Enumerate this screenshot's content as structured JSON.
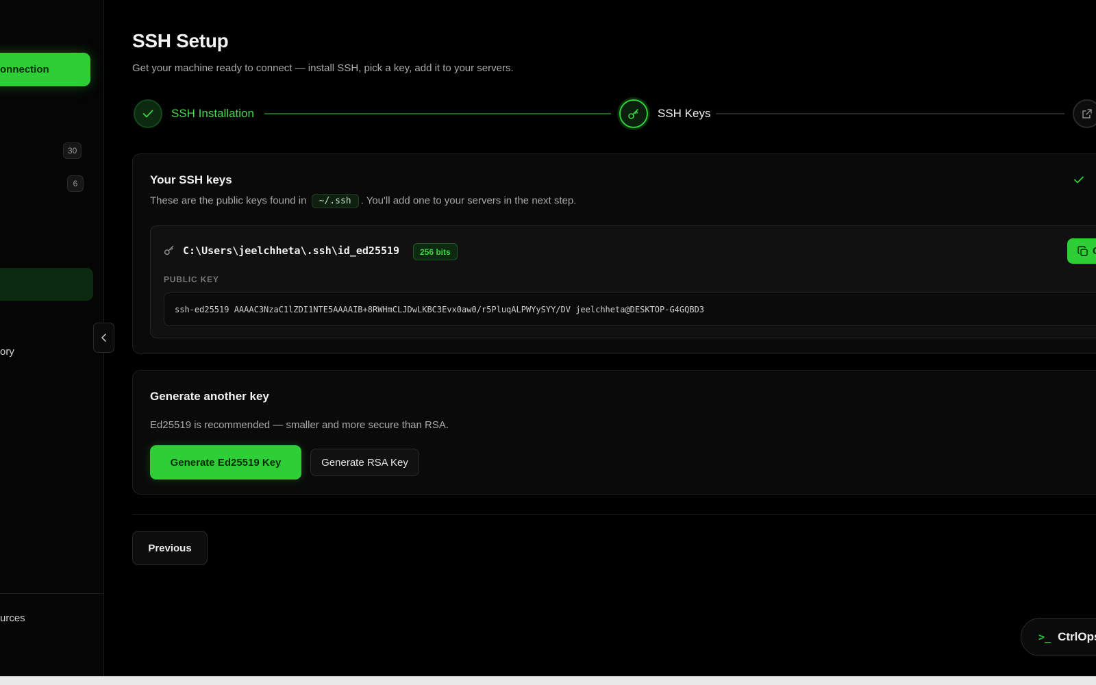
{
  "sidebar": {
    "new_connection_label": "onnection",
    "badge_a": "30",
    "badge_b": "6",
    "item_history_fragment": "ory",
    "item_resources_fragment": "urces",
    "collapse_icon": "chevron-left-icon"
  },
  "page": {
    "title": "SSH Setup",
    "subtitle": "Get your machine ready to connect — install SSH, pick a key, add it to your servers."
  },
  "stepper": {
    "steps": [
      {
        "label": "SSH Installation",
        "status": "complete",
        "icon": "check-icon"
      },
      {
        "label": "SSH Keys",
        "status": "current",
        "icon": "key-icon"
      },
      {
        "label": "",
        "status": "upcoming",
        "icon": "external-link-icon"
      }
    ]
  },
  "keys_card": {
    "title": "Your SSH keys",
    "desc_before": "These are the public keys found in",
    "desc_code": "~/.ssh",
    "desc_after": ". You'll add one to your servers in the next step.",
    "keys": [
      {
        "path": "C:\\Users\\jeelchheta\\.ssh\\id_ed25519",
        "bits": "256 bits",
        "public_key_label": "PUBLIC KEY",
        "public_key": "ssh-ed25519 AAAAC3NzaC1lZDI1NTE5AAAAIB+8RWHmCLJDwLKBC3Evx0aw0/r5PluqALPWYySYY/DV jeelchheta@DESKTOP-G4GQBD3",
        "copy_label": "C"
      }
    ]
  },
  "generate_card": {
    "title": "Generate another key",
    "desc": "Ed25519 is recommended — smaller and more secure than RSA.",
    "primary_button": "Generate Ed25519 Key",
    "secondary_button": "Generate RSA Key"
  },
  "footer": {
    "previous_label": "Previous"
  },
  "brand": {
    "prompt": ">_",
    "name": "CtrlOps"
  },
  "colors": {
    "accent": "#2ecf36",
    "background": "#000000",
    "card": "#0a0a0a"
  }
}
